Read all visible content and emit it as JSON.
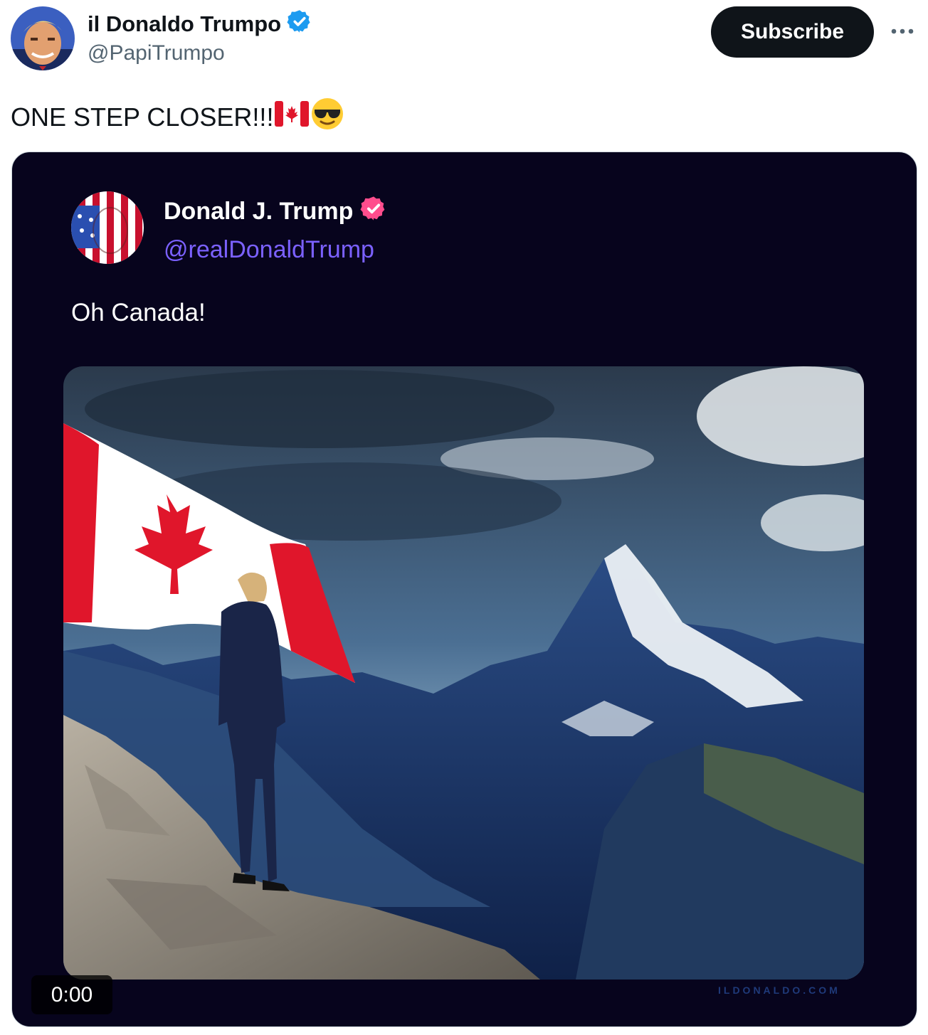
{
  "author": {
    "display_name": "il Donaldo Trumpo",
    "handle": "@PapiTrumpo",
    "avatar_icon": "profile-avatar",
    "verified_icon": "verified-badge-icon"
  },
  "actions": {
    "subscribe_label": "Subscribe",
    "more_icon": "more-options-icon"
  },
  "tweet": {
    "text": "ONE STEP CLOSER!!!",
    "emojis": [
      "canada-flag-icon",
      "sunglasses-face-icon"
    ]
  },
  "media": {
    "inner_post": {
      "display_name": "Donald J. Trump",
      "handle": "@realDonaldTrump",
      "text": "Oh Canada!"
    },
    "video_time": "0:00",
    "watermark": "ILDONALDO.COM"
  },
  "colors": {
    "verified_blue": "#1d9bf0",
    "inner_badge_pink": "#ff4d8d",
    "inner_handle": "#7b61ff",
    "media_bg": "#07041d"
  }
}
